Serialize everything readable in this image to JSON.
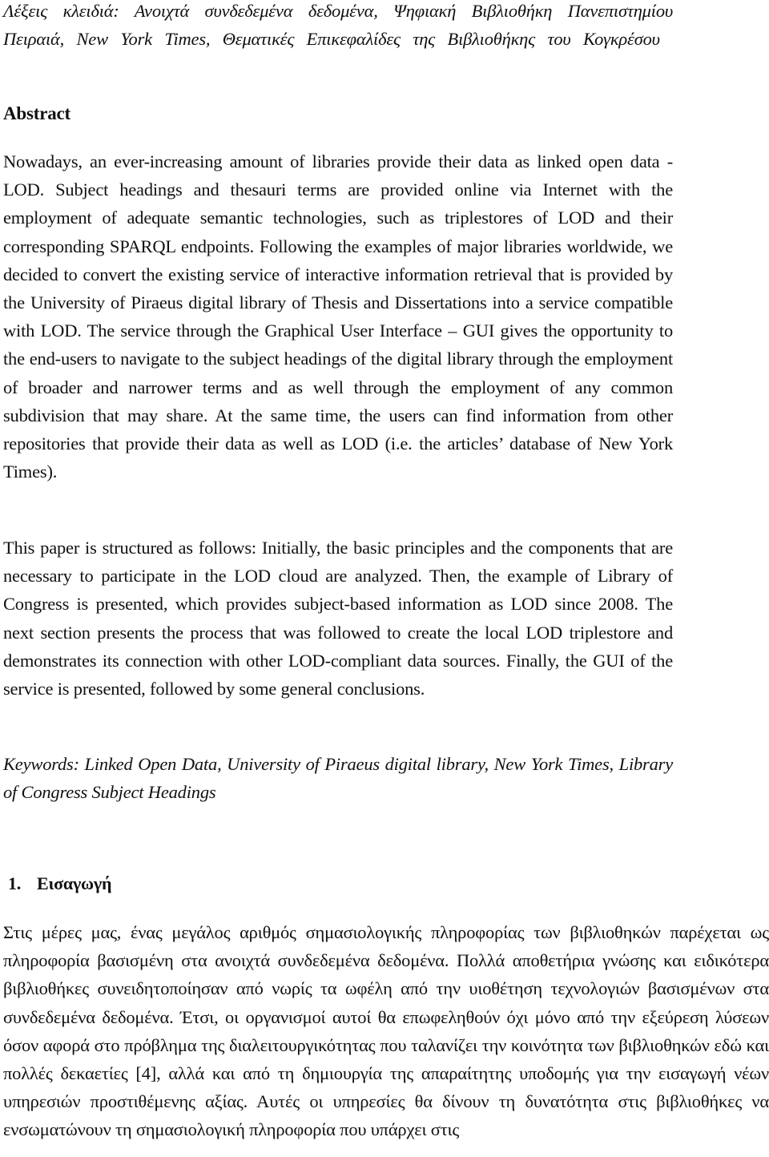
{
  "document": {
    "greek_keywords": "Λέξεις κλειδιά: Ανοιχτά συνδεδεμένα δεδομένα, Ψηφιακή Βιβλιοθήκη Πανεπιστημίου Πειραιά, New York Times, Θεματικές Επικεφαλίδες της Βιβλιοθήκης του Κογκρέσου",
    "abstract_heading": "Abstract",
    "abstract_body": "Nowadays, an ever-increasing amount of libraries provide their data as linked open data - LOD. Subject headings and thesauri terms are provided online via Internet with the employment of adequate semantic technologies, such as triplestores of LOD and their corresponding SPARQL endpoints. Following the examples of major libraries worldwide, we decided to convert the existing service of interactive information retrieval that is provided by the University of Piraeus digital library of Thesis and Dissertations into a service compatible with LOD. The service through the Graphical User Interface – GUI gives the opportunity to the end-users to navigate to the subject headings of the digital library through the employment of broader and narrower terms and as well through the employment of any common subdivision that may share. At the same time, the users can find information from other repositories that provide their data as well as LOD (i.e. the articles’ database of New York Times).",
    "structure_paragraph": "This paper is structured as follows: Initially, the basic principles and the components that are necessary to participate in the LOD cloud are analyzed. Then, the example of Library of Congress is presented, which provides subject-based information as LOD since 2008. The next section presents the process that was followed to create the local LOD triplestore and demonstrates its connection with other LOD-compliant data sources. Finally, the GUI of the service is presented, followed by some general conclusions.",
    "english_keywords": "Keywords: Linked Open Data, University of Piraeus digital library, New York Times, Library of Congress Subject Headings",
    "section": {
      "number": "1.",
      "title": "Εισαγωγή"
    },
    "intro_paragraph": "Στις μέρες μας, ένας μεγάλος αριθμός σημασιολογικής πληροφορίας των βιβλιοθηκών παρέχεται ως πληροφορία βασισμένη στα ανοιχτά συνδεδεμένα δεδομένα. Πολλά αποθετήρια γνώσης και ειδικότερα βιβλιοθήκες συνειδητοποίησαν από νωρίς τα ωφέλη από την υιοθέτηση τεχνολογιών βασισμένων στα συνδεδεμένα δεδομένα. Έτσι, οι οργανισμοί αυτοί θα επωφεληθούν όχι μόνο από την εξεύρεση λύσεων όσον αφορά στο πρόβλημα της διαλειτουργικότητας που ταλανίζει την κοινότητα των βιβλιοθηκών εδώ και πολλές δεκαετίες [4], αλλά και από τη δημιουργία της απαραίτητης υποδομής για την εισαγωγή νέων υπηρεσιών προστιθέμενης αξίας. Αυτές οι υπηρεσίες θα δίνουν τη δυνατότητα στις βιβλιοθήκες να ενσωματώνουν τη σημασιολογική πληροφορία που υπάρχει στις"
  }
}
